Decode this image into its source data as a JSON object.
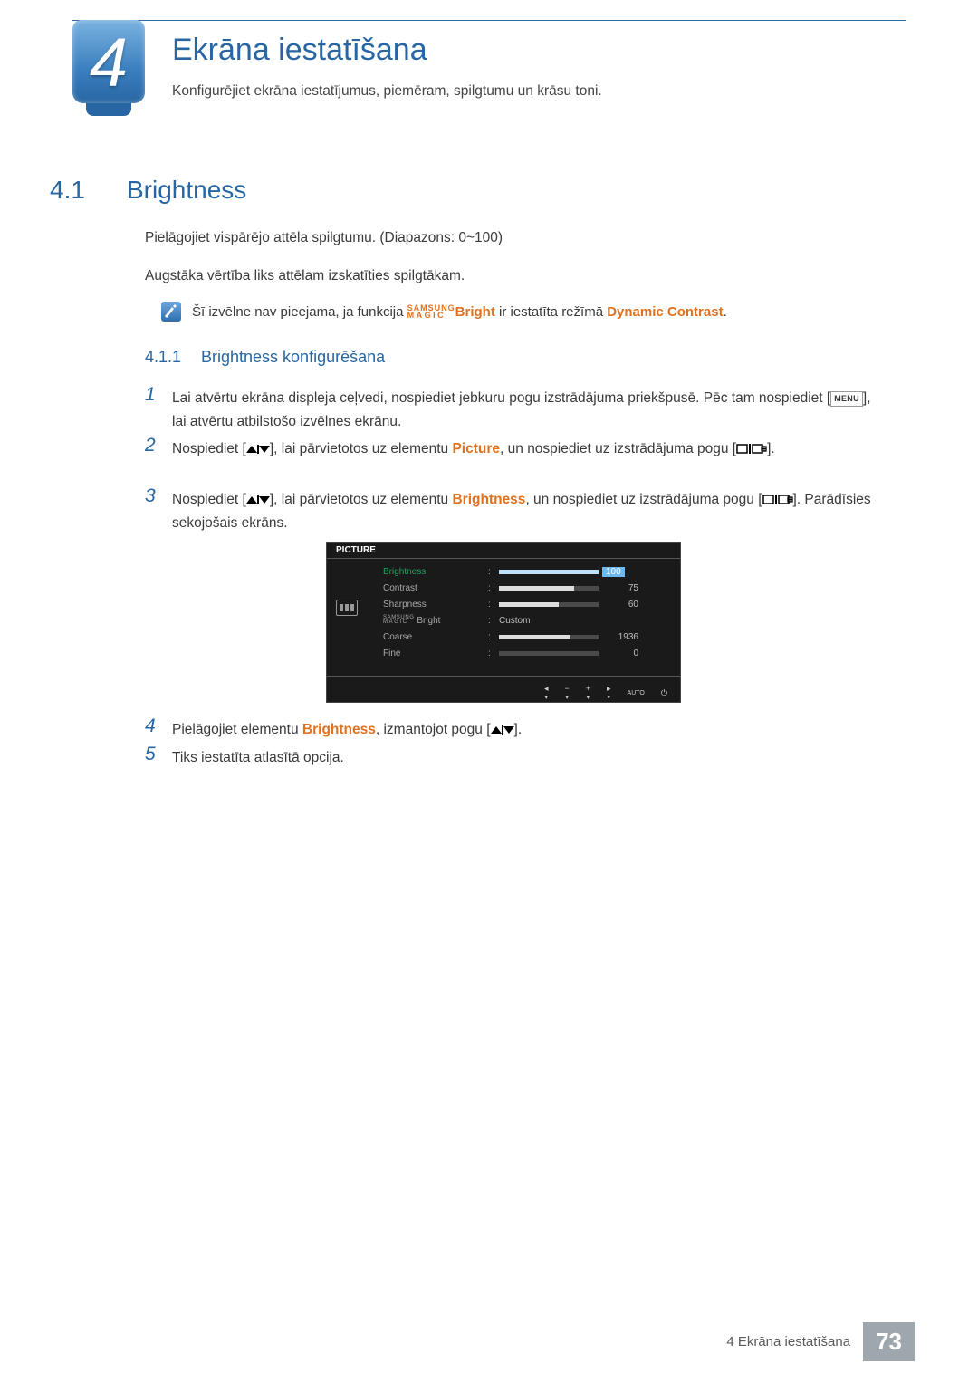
{
  "chapter": {
    "number": "4",
    "title": "Ekrāna iestatīšana",
    "subtitle": "Konfigurējiet ekrāna iestatījumus, piemēram, spilgtumu un krāsu toni."
  },
  "section": {
    "number": "4.1",
    "title": "Brightness"
  },
  "p1": "Pielāgojiet vispārējo attēla spilgtumu. (Diapazons: 0~100)",
  "p2": "Augstāka vērtība liks attēlam izskatīties spilgtākam.",
  "note": {
    "pre": "Šī izvēlne nav pieejama, ja funkcija ",
    "magic_top": "SAMSUNG",
    "magic_bot": "MAGIC",
    "bright": "Bright",
    "mid": " ir iestatīta režīmā ",
    "dc": "Dynamic Contrast",
    "post": "."
  },
  "subsection": {
    "number": "4.1.1",
    "title": "Brightness konfigurēšana"
  },
  "steps": {
    "1": {
      "n": "1",
      "a": "Lai atvērtu ekrāna displeja ceļvedi, nospiediet jebkuru pogu izstrādājuma priekšpusē. Pēc tam nospiediet [",
      "menu": "MENU",
      "b": "], lai atvērtu atbilstošo izvēlnes ekrānu."
    },
    "2": {
      "n": "2",
      "a": "Nospiediet [",
      "b": "], lai pārvietotos uz elementu ",
      "picture": "Picture",
      "c": ", un nospiediet uz izstrādājuma pogu [",
      "d": "]."
    },
    "3": {
      "n": "3",
      "a": "Nospiediet [",
      "b": "], lai pārvietotos uz elementu ",
      "bright": "Brightness",
      "c": ", un nospiediet uz izstrādājuma pogu [",
      "d": "]. Parādīsies sekojošais ekrāns."
    },
    "4": {
      "n": "4",
      "a": "Pielāgojiet elementu ",
      "bright": "Brightness",
      "b": ", izmantojot pogu [",
      "c": "]."
    },
    "5": {
      "n": "5",
      "a": "Tiks iestatīta atlasītā opcija."
    }
  },
  "osd": {
    "title": "PICTURE",
    "rows": [
      {
        "name": "Brightness",
        "value": "100",
        "pct": 100,
        "active": true
      },
      {
        "name": "Contrast",
        "value": "75",
        "pct": 75
      },
      {
        "name": "Sharpness",
        "value": "60",
        "pct": 60
      },
      {
        "name_magic_top": "SAMSUNG",
        "name_magic_bot": "MAGIC",
        "name_suffix": " Bright",
        "text": "Custom"
      },
      {
        "name": "Coarse",
        "value": "1936",
        "pct": 72
      },
      {
        "name": "Fine",
        "value": "0",
        "pct": 0
      }
    ],
    "foot": {
      "back": "◂",
      "minus": "−",
      "plus": "+",
      "enter": "▸",
      "auto": "AUTO",
      "power": "⏻",
      "tri": "▾"
    }
  },
  "footer": {
    "crumb": "4 Ekrāna iestatīšana",
    "page": "73"
  }
}
